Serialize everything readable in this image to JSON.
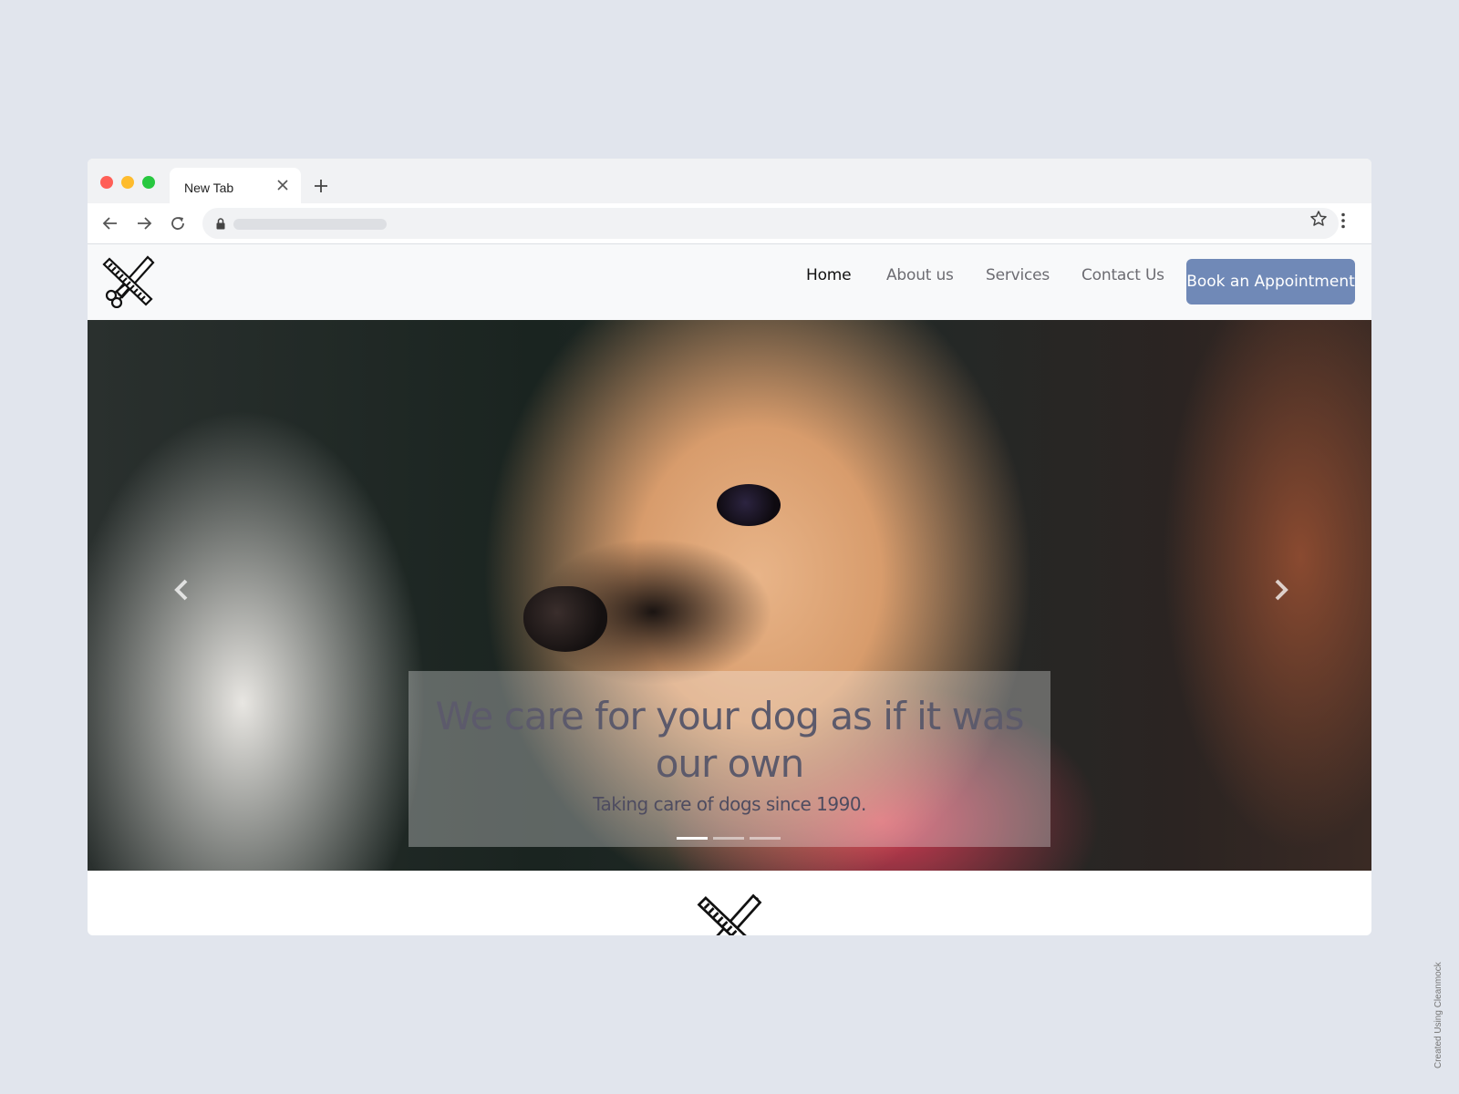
{
  "browser": {
    "tab_title": "New Tab"
  },
  "nav": {
    "links": [
      {
        "label": "Home",
        "active": true
      },
      {
        "label": "About us",
        "active": false
      },
      {
        "label": "Services",
        "active": false
      },
      {
        "label": "Contact Us",
        "active": false
      }
    ],
    "cta_label": "Book an Appointment"
  },
  "hero": {
    "title": "We care for your dog as if it was our own",
    "subtitle": "Taking care of dogs since 1990.",
    "slides": 3,
    "active_slide": 0
  },
  "icons": {
    "logo": "scissors-comb-icon",
    "prev": "chevron-left-icon",
    "next": "chevron-right-icon"
  },
  "colors": {
    "page_background": "#e1e5ed",
    "cta_background": "#7089b7",
    "nav_background": "#f8f9fa"
  },
  "watermark": "Created Using Cleanmock"
}
